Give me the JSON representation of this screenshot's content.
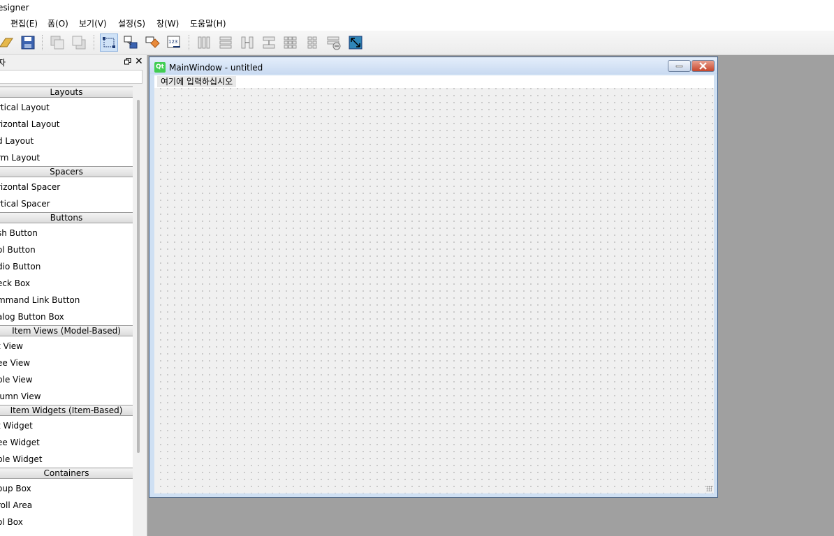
{
  "app": {
    "title": "esigner"
  },
  "menubar": {
    "items": [
      "편집(E)",
      "폼(O)",
      "보기(V)",
      "설정(S)",
      "창(W)",
      "도움말(H)"
    ]
  },
  "toolbar": {
    "buttons": [
      "open-icon",
      "save-icon",
      "bring-to-front-icon",
      "send-to-back-icon",
      "edit-widgets-icon",
      "edit-signals-slots-icon",
      "edit-buddies-icon",
      "edit-tab-order-icon",
      "layout-horizontal-icon",
      "layout-vertical-icon",
      "layout-horizontal-splitter-icon",
      "layout-vertical-splitter-icon",
      "layout-grid-icon",
      "layout-form-icon",
      "break-layout-icon",
      "adjust-size-icon"
    ]
  },
  "widget_box": {
    "title": "자",
    "categories": [
      {
        "name": "Layouts",
        "items": [
          "rtical Layout",
          "rizontal Layout",
          "d Layout",
          "rm Layout"
        ]
      },
      {
        "name": "Spacers",
        "items": [
          "rizontal Spacer",
          "rtical Spacer"
        ]
      },
      {
        "name": "Buttons",
        "items": [
          "sh Button",
          "ol Button",
          "dio Button",
          "eck Box",
          "mmand Link Button",
          "alog Button Box"
        ]
      },
      {
        "name": "Item Views (Model-Based)",
        "items": [
          "t View",
          "ee View",
          "ble View",
          "lumn View"
        ]
      },
      {
        "name": "Item Widgets (Item-Based)",
        "items": [
          "t Widget",
          "ee Widget",
          "ble Widget"
        ]
      },
      {
        "name": "Containers",
        "items": [
          "oup Box",
          "roll Area",
          "ol Box"
        ]
      }
    ]
  },
  "form": {
    "caption": "MainWindow - untitled",
    "logo_text": "Qt",
    "menu_placeholder": "여기에 입력하십시오"
  },
  "colors": {
    "mdi_background": "#a0a0a0",
    "form_frame": "#cfe0f3",
    "close_button": "#c6452b",
    "qt_logo": "#41cd52"
  }
}
